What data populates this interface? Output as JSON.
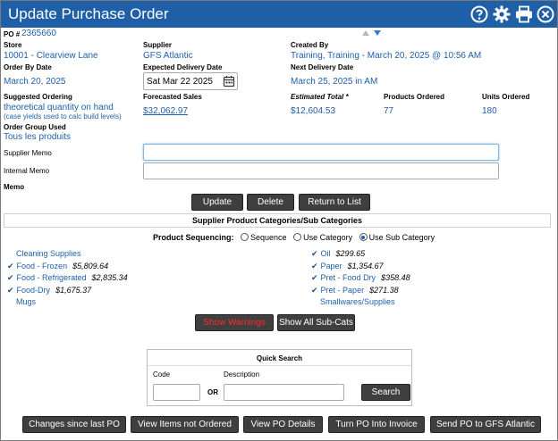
{
  "window": {
    "title": "Update Purchase Order"
  },
  "po": {
    "label": "PO #",
    "number": "2365660"
  },
  "store": {
    "label": "Store",
    "value": "10001 - Clearview Lane"
  },
  "supplier": {
    "label": "Supplier",
    "value": "GFS Atlantic"
  },
  "created_by": {
    "label": "Created By",
    "value": "Training, Training - March 20, 2025 @ 10:56 AM"
  },
  "order_by_date": {
    "label": "Order By Date",
    "value": "March 20, 2025"
  },
  "expected_delivery": {
    "label": "Expected Delivery Date",
    "value": "Sat Mar 22 2025"
  },
  "next_delivery": {
    "label": "Next Delivery Date",
    "value": "March 25, 2025 in AM"
  },
  "suggested_ordering": {
    "label": "Suggested Ordering",
    "value": "theoretical quantity on hand",
    "note": "(case yields used to calc build levels)"
  },
  "forecasted_sales": {
    "label": "Forecasted Sales",
    "value": "$32,062.97"
  },
  "estimated_total": {
    "label": "Estimated Total *",
    "value": "$12,604.53"
  },
  "products_ordered": {
    "label": "Products Ordered",
    "value": "77"
  },
  "units_ordered": {
    "label": "Units Ordered",
    "value": "180"
  },
  "order_group": {
    "label": "Order Group Used",
    "value": "Tous les produits"
  },
  "supplier_memo": {
    "label": "Supplier Memo",
    "value": ""
  },
  "internal_memo": {
    "label": "Internal Memo",
    "value": ""
  },
  "memo": {
    "label": "Memo"
  },
  "actions": {
    "update": "Update",
    "delete": "Delete",
    "return": "Return to List"
  },
  "categories_section": {
    "title": "Supplier Product Categories/Sub Categories",
    "sequencing_label": "Product Sequencing:",
    "options": [
      "Sequence",
      "Use Category",
      "Use Sub Category"
    ],
    "selected": "Use Sub Category"
  },
  "categories_left": [
    {
      "name": "Cleaning Supplies",
      "amount": "",
      "checked": false
    },
    {
      "name": "Food - Frozen",
      "amount": "$5,809.64",
      "checked": true
    },
    {
      "name": "Food - Refrigerated",
      "amount": "$2,835.34",
      "checked": true
    },
    {
      "name": "Food-Dry",
      "amount": "$1,675.37",
      "checked": true
    },
    {
      "name": "Mugs",
      "amount": "",
      "checked": false
    }
  ],
  "categories_right": [
    {
      "name": "Oil",
      "amount": "$299.65",
      "checked": true
    },
    {
      "name": "Paper",
      "amount": "$1,354.67",
      "checked": true
    },
    {
      "name": "Pret - Food Dry",
      "amount": "$358.48",
      "checked": true
    },
    {
      "name": "Pret - Paper",
      "amount": "$271.38",
      "checked": true
    },
    {
      "name": "Smallwares/Supplies",
      "amount": "",
      "checked": false
    }
  ],
  "sub_buttons": {
    "show_warnings": "Show Warnings",
    "show_all": "Show All Sub-Cats"
  },
  "quick_search": {
    "title": "Quick Search",
    "code_label": "Code",
    "or_label": "OR",
    "description_label": "Description",
    "search_button": "Search",
    "code_value": "",
    "description_value": ""
  },
  "footer": {
    "changes": "Changes since last PO",
    "not_ordered": "View Items not Ordered",
    "details": "View PO Details",
    "invoice": "Turn PO Into Invoice",
    "send": "Send PO to GFS Atlantic"
  },
  "colors": {
    "titlebar": "#1f5fa8",
    "link": "#1f5fa8",
    "button": "#3f3f3f",
    "warning_text": "#ff2a2a"
  },
  "icons": [
    "help-icon",
    "gear-icon",
    "print-icon",
    "close-icon",
    "calendar-icon",
    "check-icon",
    "sort-arrows-icon"
  ]
}
